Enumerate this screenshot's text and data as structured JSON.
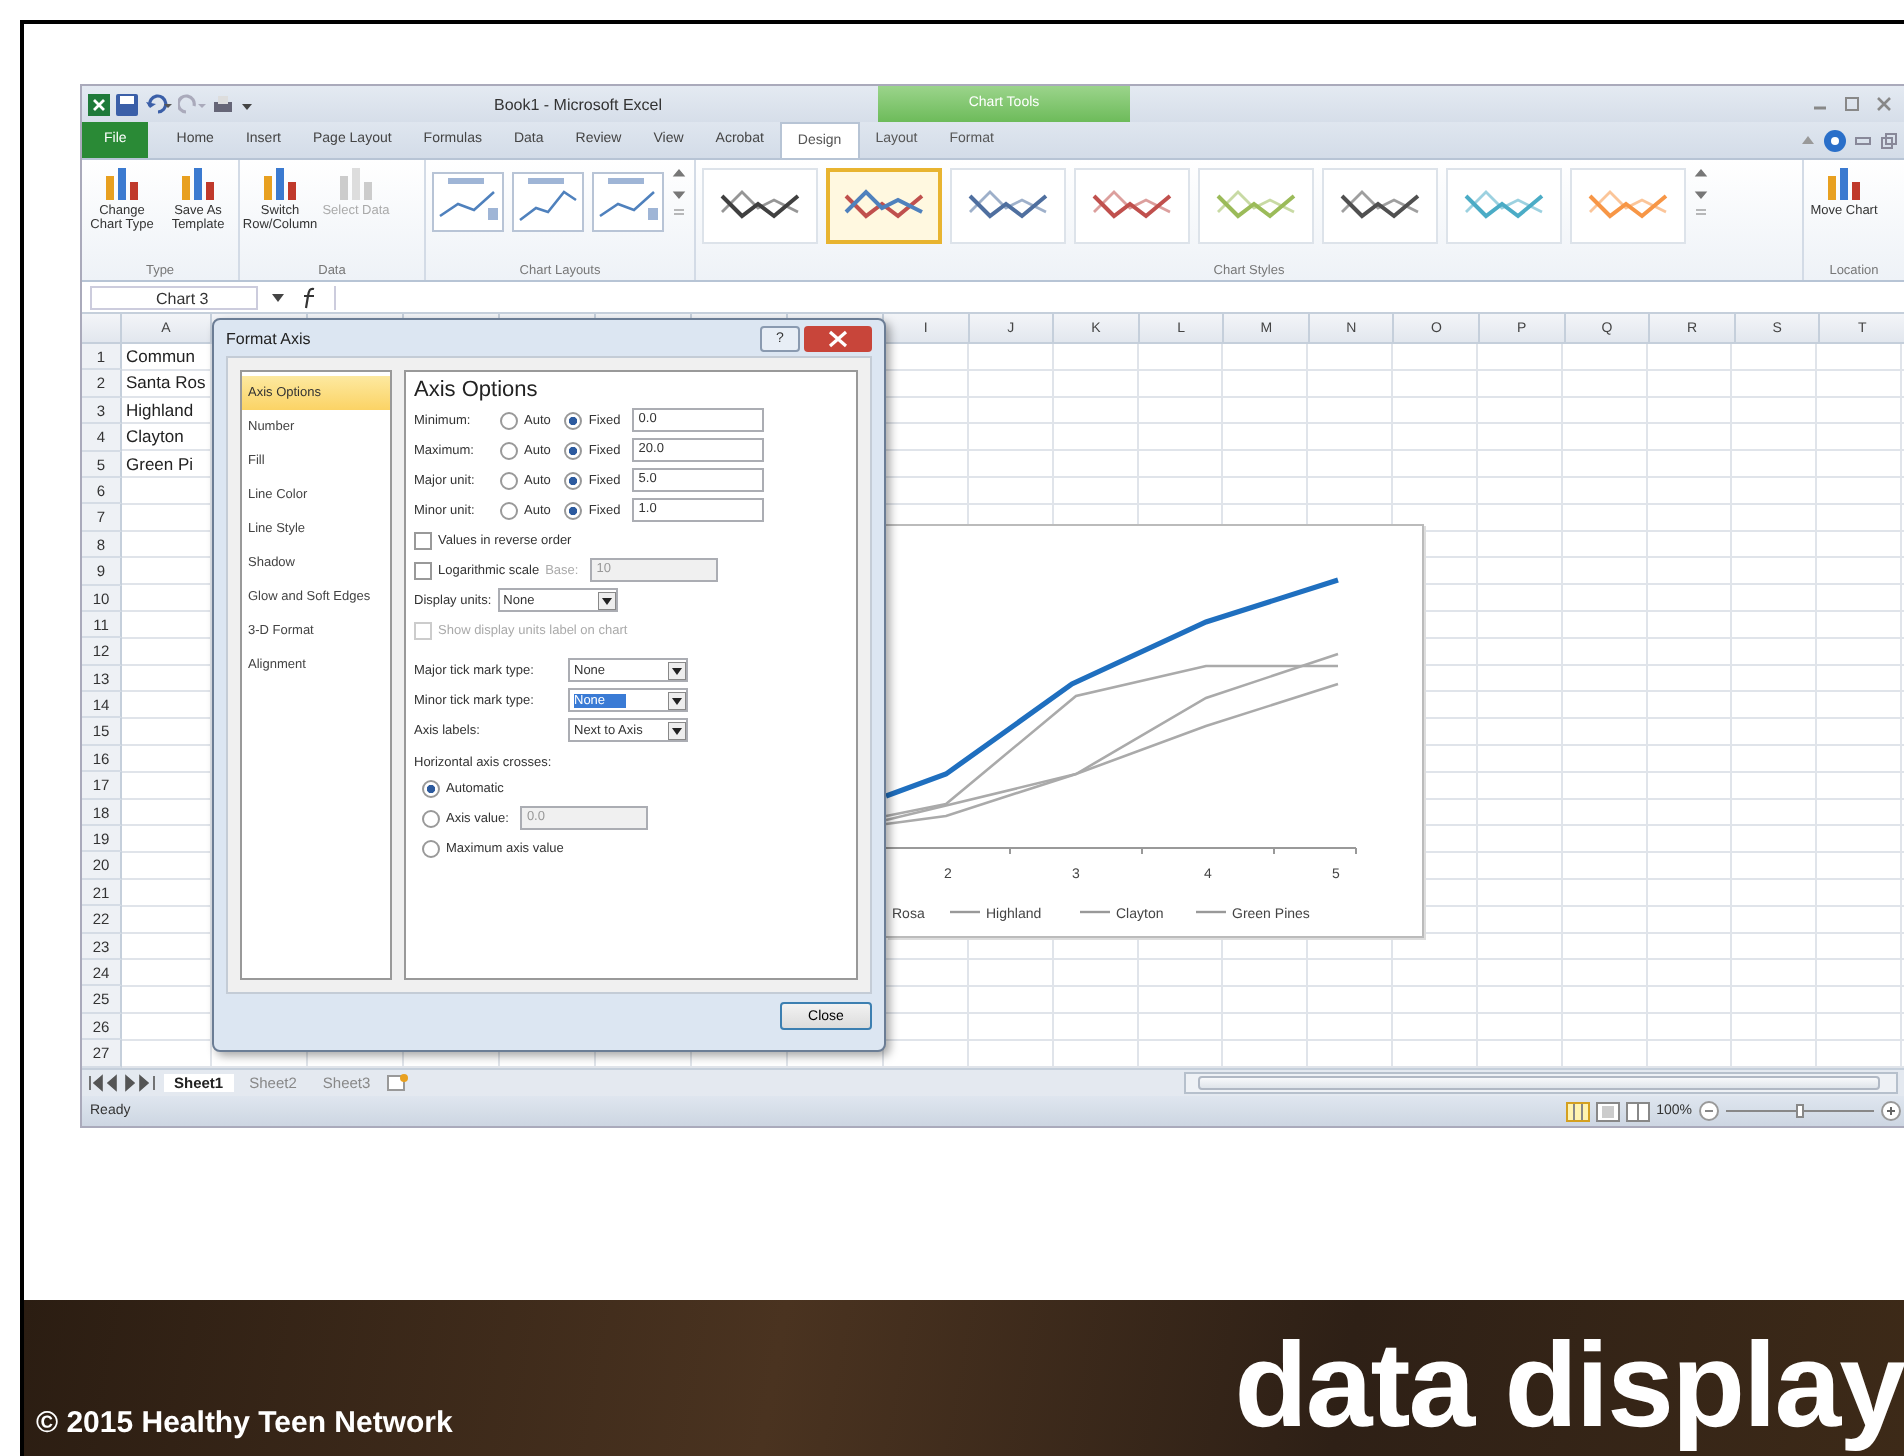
{
  "excel": {
    "title": "Book1 - Microsoft Excel",
    "context_group": "Chart Tools",
    "tabs": [
      {
        "label": "File",
        "kind": "file",
        "selected": false
      },
      {
        "label": "Home",
        "kind": "plain",
        "selected": false
      },
      {
        "label": "Insert",
        "kind": "plain",
        "selected": false
      },
      {
        "label": "Page Layout",
        "kind": "plain",
        "selected": false
      },
      {
        "label": "Formulas",
        "kind": "plain",
        "selected": false
      },
      {
        "label": "Data",
        "kind": "plain",
        "selected": false
      },
      {
        "label": "Review",
        "kind": "plain",
        "selected": false
      },
      {
        "label": "View",
        "kind": "plain",
        "selected": false
      },
      {
        "label": "Acrobat",
        "kind": "plain",
        "selected": false
      },
      {
        "label": "Design",
        "kind": "context",
        "selected": true
      },
      {
        "label": "Layout",
        "kind": "context",
        "selected": false
      },
      {
        "label": "Format",
        "kind": "context",
        "selected": false
      }
    ],
    "ribbon_groups": [
      {
        "label": "Type",
        "kind": "buttons",
        "buttons": [
          {
            "label": "Change Chart Type",
            "disabled": false
          },
          {
            "label": "Save As Template",
            "disabled": false
          }
        ]
      },
      {
        "label": "Data",
        "kind": "buttons",
        "buttons": [
          {
            "label": "Switch Row/Column",
            "disabled": false
          },
          {
            "label": "Select Data",
            "disabled": true
          }
        ]
      },
      {
        "label": "Chart Layouts",
        "kind": "layouts"
      },
      {
        "label": "Chart Styles",
        "kind": "styles",
        "styles": [
          {
            "kind": "mono",
            "color": "#404040",
            "selected": false
          },
          {
            "kind": "multi",
            "color": "#c0504d",
            "selected": true
          },
          {
            "kind": "mono",
            "color": "#4f6f9f",
            "selected": false
          },
          {
            "kind": "mono",
            "color": "#c0504d",
            "selected": false
          },
          {
            "kind": "mono",
            "color": "#9bbb59",
            "selected": false
          },
          {
            "kind": "mono",
            "color": "#505050",
            "selected": false
          },
          {
            "kind": "mono",
            "color": "#4bacc6",
            "selected": false
          },
          {
            "kind": "mono",
            "color": "#f79646",
            "selected": false
          }
        ]
      },
      {
        "label": "Location",
        "kind": "buttons",
        "buttons": [
          {
            "label": "Move Chart",
            "disabled": false
          }
        ]
      }
    ],
    "name_box": "Chart 3",
    "columns": [
      "A",
      "I",
      "J",
      "K",
      "L",
      "M",
      "N",
      "O",
      "P",
      "Q",
      "R",
      "S",
      "T"
    ],
    "rows": [
      {
        "number": "1",
        "cell_a": "Commun"
      },
      {
        "number": "2",
        "cell_a": "Santa Ros"
      },
      {
        "number": "3",
        "cell_a": "Highland"
      },
      {
        "number": "4",
        "cell_a": "Clayton"
      },
      {
        "number": "5",
        "cell_a": "Green Pi"
      },
      {
        "number": "6"
      },
      {
        "number": "7"
      },
      {
        "number": "8"
      },
      {
        "number": "9"
      },
      {
        "number": "10"
      },
      {
        "number": "11"
      },
      {
        "number": "12"
      },
      {
        "number": "13"
      },
      {
        "number": "14"
      },
      {
        "number": "15"
      },
      {
        "number": "16"
      },
      {
        "number": "17"
      },
      {
        "number": "18"
      },
      {
        "number": "19"
      },
      {
        "number": "20"
      },
      {
        "number": "21"
      },
      {
        "number": "22"
      },
      {
        "number": "23"
      },
      {
        "number": "24"
      },
      {
        "number": "25"
      },
      {
        "number": "26"
      },
      {
        "number": "27"
      }
    ],
    "sheet_tabs": [
      {
        "label": "Sheet1",
        "selected": true
      },
      {
        "label": "Sheet2",
        "selected": false
      },
      {
        "label": "Sheet3",
        "selected": false
      }
    ],
    "status": "Ready",
    "zoom": "100%",
    "zoom_slider": {
      "level": 0.5
    }
  },
  "chart": {
    "x_labels": [
      "2",
      "3",
      "4",
      "5"
    ],
    "legend": [
      "Rosa",
      "Highland",
      "Clayton",
      "Green Pines"
    ]
  },
  "dialog": {
    "title": "Format Axis",
    "help": "?",
    "nav": [
      {
        "label": "Axis Options",
        "selected": true
      },
      {
        "label": "Number",
        "selected": false
      },
      {
        "label": "Fill",
        "selected": false
      },
      {
        "label": "Line Color",
        "selected": false
      },
      {
        "label": "Line Style",
        "selected": false
      },
      {
        "label": "Shadow",
        "selected": false
      },
      {
        "label": "Glow and Soft Edges",
        "selected": false
      },
      {
        "label": "3-D Format",
        "selected": false
      },
      {
        "label": "Alignment",
        "selected": false
      }
    ],
    "heading": "Axis Options",
    "bounds": [
      {
        "label": "Minimum:",
        "auto_label": "Auto",
        "fixed_label": "Fixed",
        "fixed": true,
        "value": "0.0"
      },
      {
        "label": "Maximum:",
        "auto_label": "Auto",
        "fixed_label": "Fixed",
        "fixed": true,
        "value": "20.0"
      },
      {
        "label": "Major unit:",
        "auto_label": "Auto",
        "fixed_label": "Fixed",
        "fixed": true,
        "value": "5.0"
      },
      {
        "label": "Minor unit:",
        "auto_label": "Auto",
        "fixed_label": "Fixed",
        "fixed": true,
        "value": "1.0"
      }
    ],
    "reverse": {
      "label": "Values in reverse order",
      "checked": false
    },
    "log": {
      "label": "Logarithmic scale",
      "checked": false,
      "base_label": "Base:",
      "base": "10"
    },
    "display_units": {
      "label": "Display units:",
      "value": "None"
    },
    "show_units_label": {
      "label": "Show display units label on chart",
      "checked": false,
      "disabled": true
    },
    "dropdowns": [
      {
        "label": "Major tick mark type:",
        "value": "None",
        "focused": false
      },
      {
        "label": "Minor tick mark type:",
        "value": "None",
        "focused": true
      },
      {
        "label": "Axis labels:",
        "value": "Next to Axis",
        "focused": false
      }
    ],
    "crosses_label": "Horizontal axis crosses:",
    "crosses": [
      {
        "label": "Automatic",
        "kind": "plain",
        "selected": true
      },
      {
        "label": "Axis value:",
        "kind": "input",
        "value": "0.0",
        "selected": false
      },
      {
        "label": "Maximum axis value",
        "kind": "plain",
        "selected": false
      }
    ],
    "close": "Close"
  },
  "slide": {
    "copyright": "© 2015 Healthy Teen Network",
    "title": "data display"
  }
}
